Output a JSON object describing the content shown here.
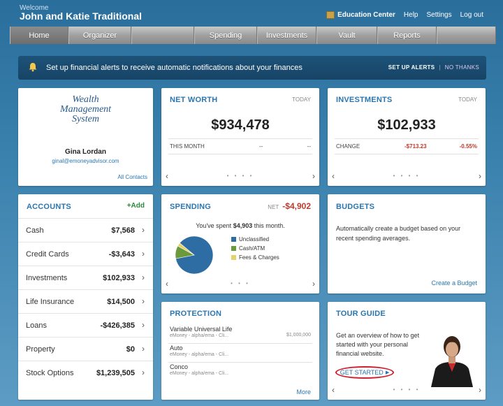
{
  "header": {
    "welcome": "Welcome",
    "user": "John and Katie Traditional",
    "links": {
      "education": "Education Center",
      "help": "Help",
      "settings": "Settings",
      "logout": "Log out"
    }
  },
  "nav": {
    "tabs": [
      "Home",
      "Organizer",
      "",
      "Spending",
      "Investments",
      "Vault",
      "Reports",
      ""
    ]
  },
  "alert": {
    "text": "Set up financial alerts to receive automatic notifications about your finances",
    "setup": "SET UP ALERTS",
    "sep": "|",
    "no_thanks": "NO THANKS"
  },
  "advisor": {
    "logo_line1": "Wealth",
    "logo_line2": "Management",
    "logo_line3": "System",
    "name": "Gina Lordan",
    "email": "ginal@emoneyadvisor.com",
    "all_contacts": "All Contacts"
  },
  "networth": {
    "title": "NET WORTH",
    "period": "TODAY",
    "value": "$934,478",
    "row_label": "THIS MONTH",
    "row_val1": "--",
    "row_val2": "--"
  },
  "investments": {
    "title": "INVESTMENTS",
    "period": "TODAY",
    "value": "$102,933",
    "row_label": "CHANGE",
    "change": "-$713.23",
    "change_pct": "-0.55%"
  },
  "accounts": {
    "title": "ACCOUNTS",
    "add": "+Add",
    "items": [
      {
        "label": "Cash",
        "value": "$7,568"
      },
      {
        "label": "Credit Cards",
        "value": "-$3,643"
      },
      {
        "label": "Investments",
        "value": "$102,933"
      },
      {
        "label": "Life Insurance",
        "value": "$14,500"
      },
      {
        "label": "Loans",
        "value": "-$426,385"
      },
      {
        "label": "Property",
        "value": "$0"
      },
      {
        "label": "Stock Options",
        "value": "$1,239,505"
      }
    ]
  },
  "spending": {
    "title": "SPENDING",
    "net_label": "NET",
    "net_value": "-$4,902",
    "summary_pre": "You've spent ",
    "summary_amt": "$4,903",
    "summary_post": " this month.",
    "legend": [
      {
        "label": "Unclassified",
        "color": "#2e6da4",
        "share": 0.86
      },
      {
        "label": "Cash/ATM",
        "color": "#6a9a3c",
        "share": 0.11
      },
      {
        "label": "Fees & Charges",
        "color": "#e3d36a",
        "share": 0.03
      }
    ]
  },
  "budgets": {
    "title": "BUDGETS",
    "text": "Automatically create a budget based on your recent spending averages.",
    "link": "Create a Budget"
  },
  "protection": {
    "title": "PROTECTION",
    "items": [
      {
        "name": "Variable Universal Life",
        "sub": "eMoney - alpha/ema - Cli...",
        "amount": "$1,000,000"
      },
      {
        "name": "Auto",
        "sub": "eMoney - alpha/ema - Cli...",
        "amount": ""
      },
      {
        "name": "Conco",
        "sub": "eMoney - alpha/ema - Cli...",
        "amount": ""
      }
    ],
    "more": "More"
  },
  "tour": {
    "title": "TOUR GUIDE",
    "text": "Get an overview of how to get started with your personal financial website.",
    "cta": "GET STARTED"
  },
  "pager": {
    "left": "‹",
    "right": "›",
    "dots": "• • • •",
    "dots3": "• • •"
  }
}
